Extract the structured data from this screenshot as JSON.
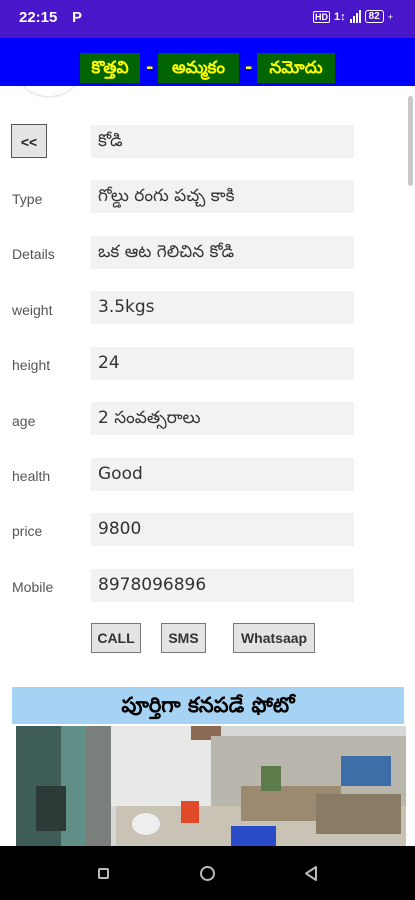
{
  "status": {
    "time": "22:15",
    "p_icon": "P",
    "hd": "HD",
    "lte": "1↕",
    "signal_icon": "signal-icon",
    "battery": "82"
  },
  "title": {
    "word1": "కొత్తవి",
    "sep1": "-",
    "word2": "అమ్మకం",
    "sep2": "-",
    "word3": "నమోదు"
  },
  "back_button": "<<",
  "name_value": "కోడి",
  "fields": [
    {
      "label": "Type",
      "value": "గోల్డు రంగు పచ్చ కాకి"
    },
    {
      "label": "Details",
      "value": "ఒక ఆట గెలిచిన కోడి"
    },
    {
      "label": "weight",
      "value": "3.5kgs"
    },
    {
      "label": "height",
      "value": "24"
    },
    {
      "label": "age",
      "value": "2 సంవత్సరాలు"
    },
    {
      "label": "health",
      "value": "Good"
    },
    {
      "label": "price",
      "value": "9800"
    },
    {
      "label": "Mobile",
      "value": "8978096896"
    }
  ],
  "actions": {
    "call": "CALL",
    "sms": "SMS",
    "whatsapp": "Whatsaap"
  },
  "photo_title": "పూర్తిగా కనపడే ఫోటో",
  "nav": {
    "recents": "square-icon",
    "home": "circle-icon",
    "back": "triangle-back-icon"
  }
}
